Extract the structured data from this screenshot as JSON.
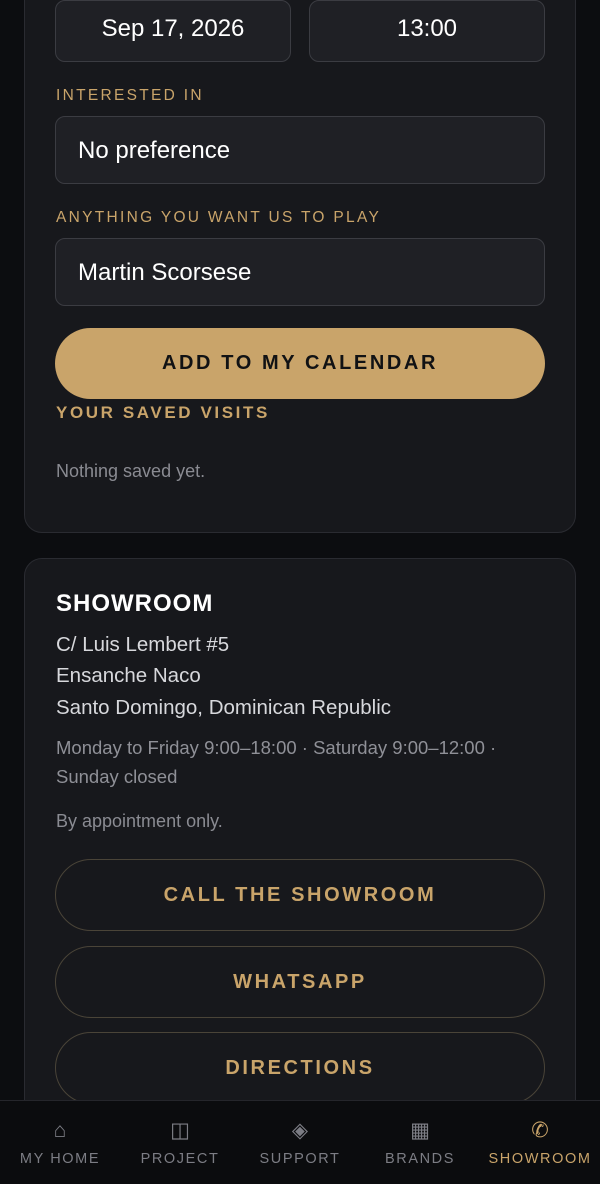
{
  "form": {
    "date_value": "Sep 17, 2026",
    "time_value": "13:00",
    "interested_label": "INTERESTED IN",
    "interested_value": "No preference",
    "play_label": "ANYTHING YOU WANT US TO PLAY",
    "play_value": "Martin Scorsese",
    "add_button": "ADD TO MY CALENDAR"
  },
  "saved": {
    "title": "YOUR SAVED VISITS",
    "empty_text": "Nothing saved yet."
  },
  "showroom": {
    "title": "SHOWROOM",
    "address_line1": "C/ Luis Lembert #5",
    "address_line2": "Ensanche Naco",
    "address_line3": "Santo Domingo, Dominican Republic",
    "hours": "Monday to Friday 9:00–18:00 · Saturday 9:00–12:00 · Sunday closed",
    "appointment": "By appointment only.",
    "call_button": "CALL THE SHOWROOM",
    "whatsapp_button": "WHATSAPP",
    "directions_button": "DIRECTIONS"
  },
  "tabs": [
    {
      "label": "MY HOME",
      "icon": "home-icon",
      "glyph": "⌂"
    },
    {
      "label": "PROJECT",
      "icon": "project-icon",
      "glyph": "◫"
    },
    {
      "label": "SUPPORT",
      "icon": "support-icon",
      "glyph": "◈"
    },
    {
      "label": "BRANDS",
      "icon": "brands-icon",
      "glyph": "▦"
    },
    {
      "label": "SHOWROOM",
      "icon": "showroom-icon",
      "glyph": "✆"
    }
  ],
  "colors": {
    "accent": "#c9a46a",
    "background": "#0c0d10",
    "card": "#17181c"
  }
}
